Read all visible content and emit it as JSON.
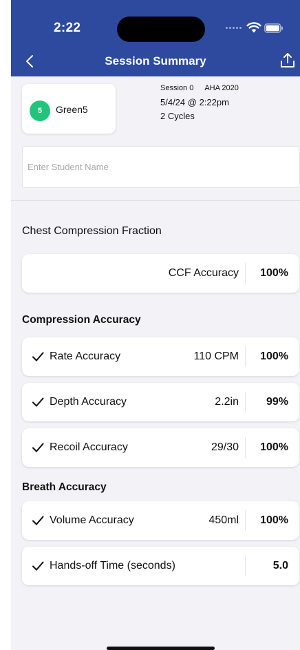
{
  "status_bar": {
    "time": "2:22"
  },
  "nav": {
    "title": "Session Summary"
  },
  "student": {
    "badge": "5",
    "name": "Green5"
  },
  "session": {
    "label": "Session 0",
    "standard": "AHA 2020",
    "datetime": "5/4/24 @ 2:22pm",
    "cycles": "2 Cycles"
  },
  "student_input": {
    "placeholder": "Enter Student Name",
    "value": ""
  },
  "sections": {
    "ccf": "Chest Compression Fraction",
    "compression": "Compression Accuracy",
    "breath": "Breath Accuracy"
  },
  "metrics": {
    "ccf": {
      "label": "CCF Accuracy",
      "value": "100%"
    },
    "rate": {
      "label": "Rate Accuracy",
      "detail": "110 CPM",
      "value": "100%"
    },
    "depth": {
      "label": "Depth Accuracy",
      "detail": "2.2in",
      "value": "99%"
    },
    "recoil": {
      "label": "Recoil Accuracy",
      "detail": "29/30",
      "value": "100%"
    },
    "volume": {
      "label": "Volume Accuracy",
      "detail": "450ml",
      "value": "100%"
    },
    "hands_off": {
      "label": "Hands-off Time (seconds)",
      "detail": "",
      "value": "5.0"
    }
  },
  "colors": {
    "header": "#2d4a9e",
    "badge": "#21c47a",
    "background": "#f2f2f7"
  }
}
